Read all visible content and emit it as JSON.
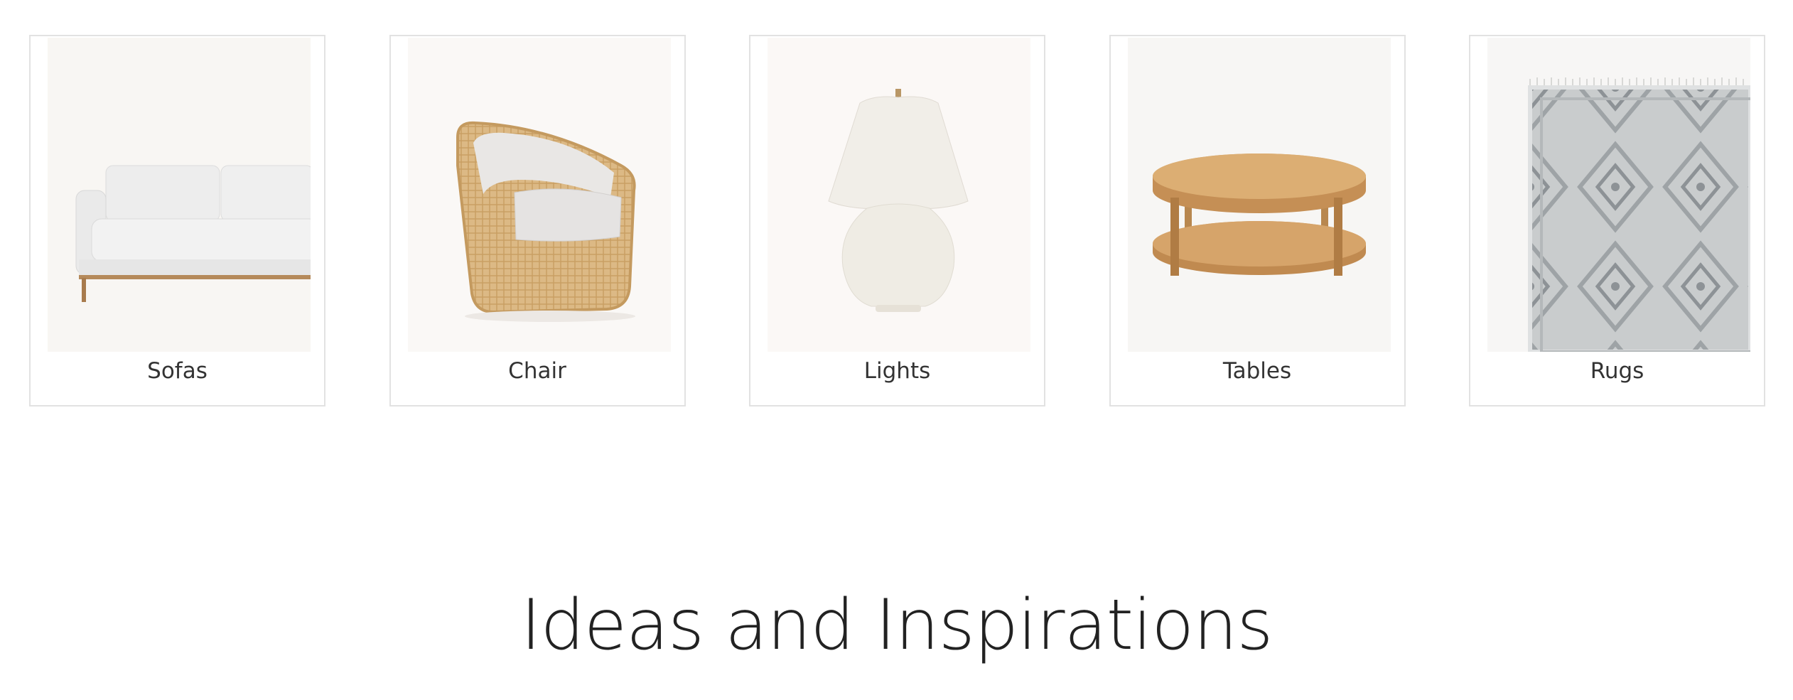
{
  "categories": [
    {
      "label": "Sofas",
      "icon": "sofa-image"
    },
    {
      "label": "Chair",
      "icon": "chair-image"
    },
    {
      "label": "Lights",
      "icon": "lamp-image"
    },
    {
      "label": "Tables",
      "icon": "table-image"
    },
    {
      "label": "Rugs",
      "icon": "rug-image"
    }
  ],
  "section": {
    "title": "Ideas and Inspirations"
  },
  "colors": {
    "card_border": "#e2e2e2",
    "image_bg": "#f8f6f4",
    "text": "#333333",
    "wicker": "#d9b682",
    "wood": "#c99a62"
  }
}
